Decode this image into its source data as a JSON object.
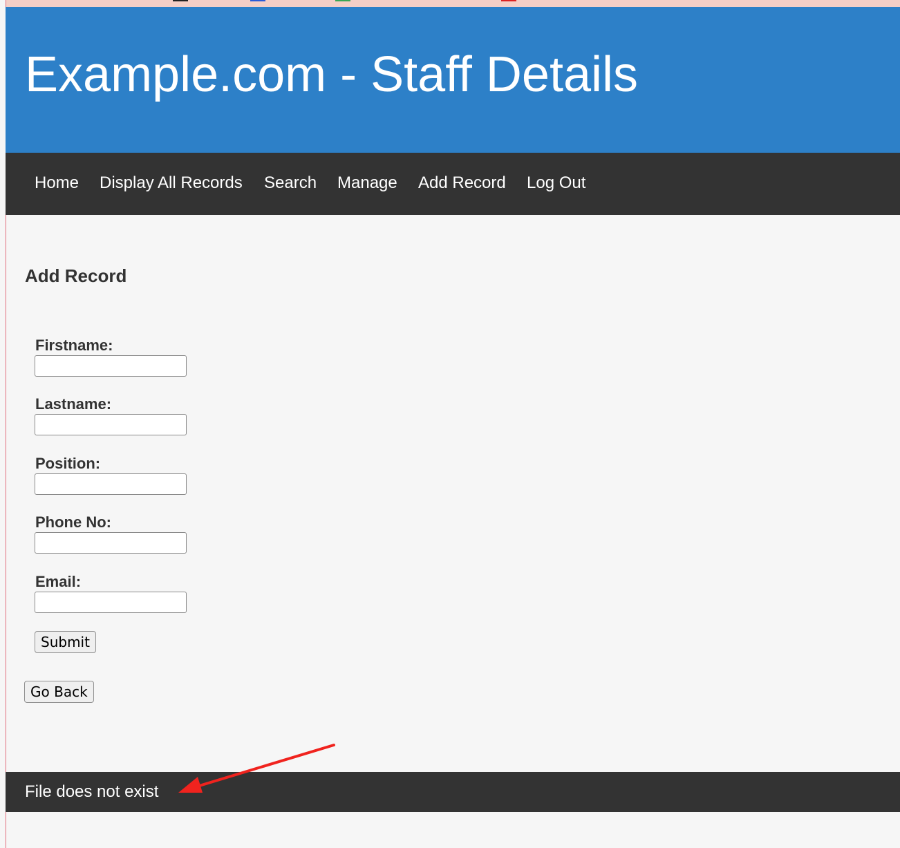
{
  "header": {
    "title": "Example.com - Staff Details"
  },
  "nav": {
    "items": [
      {
        "label": "Home"
      },
      {
        "label": "Display All Records"
      },
      {
        "label": "Search"
      },
      {
        "label": "Manage"
      },
      {
        "label": "Add Record"
      },
      {
        "label": "Log Out"
      }
    ]
  },
  "main": {
    "heading": "Add Record",
    "form": {
      "fields": [
        {
          "label": "Firstname:",
          "value": ""
        },
        {
          "label": "Lastname:",
          "value": ""
        },
        {
          "label": "Position:",
          "value": ""
        },
        {
          "label": "Phone No:",
          "value": ""
        },
        {
          "label": "Email:",
          "value": ""
        }
      ],
      "submit_label": "Submit"
    },
    "go_back_label": "Go Back"
  },
  "footer": {
    "message": "File does not exist"
  },
  "colors": {
    "header_bg": "#2d80c8",
    "nav_bg": "#333333",
    "annotation_arrow": "#f0231e"
  },
  "annotation": {
    "icon": "red-arrow-icon"
  }
}
